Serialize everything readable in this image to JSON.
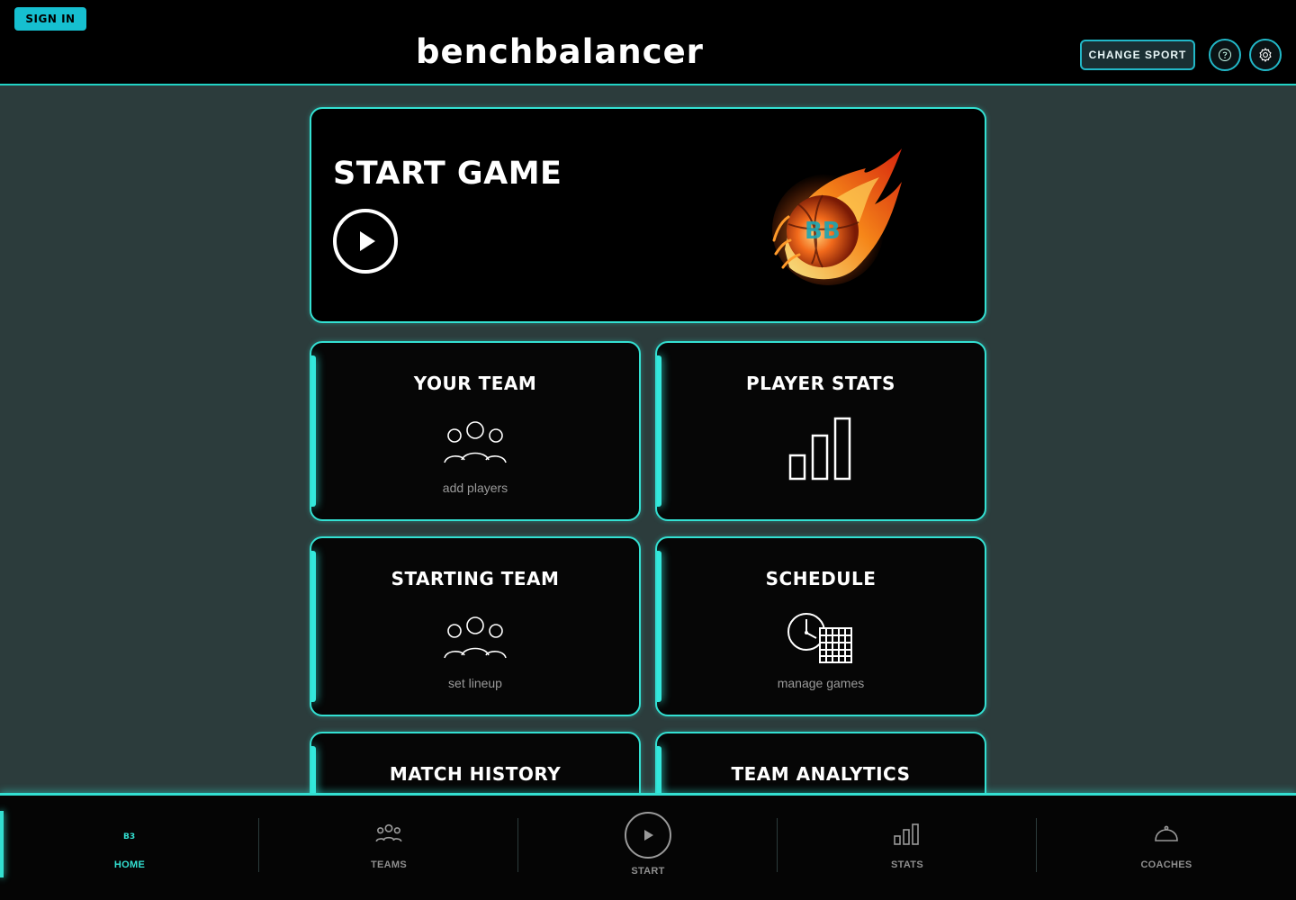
{
  "header": {
    "sign_in_label": "SIGN IN",
    "app_title": "benchbalancer",
    "change_sport_label": "CHANGE SPORT",
    "help_icon": "question-icon",
    "settings_icon": "gear-icon"
  },
  "start_game": {
    "title": "START GAME",
    "play_icon": "play-icon",
    "image": "flaming-basketball"
  },
  "tiles": {
    "your_team": {
      "title": "YOUR TEAM",
      "subtitle": "add players",
      "icon": "people-icon"
    },
    "player_stats": {
      "title": "PLAYER STATS",
      "subtitle": "",
      "icon": "bar-chart-icon"
    },
    "starting_team": {
      "title": "STARTING TEAM",
      "subtitle": "set lineup",
      "icon": "people-icon"
    },
    "schedule": {
      "title": "SCHEDULE",
      "subtitle": "manage games",
      "icon": "clock-calendar-icon"
    },
    "match_history": {
      "title": "MATCH HISTORY"
    },
    "team_analytics": {
      "title": "TEAM ANALYTICS"
    }
  },
  "bottom_nav": {
    "items": [
      {
        "label": "HOME",
        "icon": "bb-logo-icon",
        "active": true
      },
      {
        "label": "TEAMS",
        "icon": "people-icon",
        "active": false
      },
      {
        "label": "START",
        "icon": "play-icon",
        "active": false
      },
      {
        "label": "STATS",
        "icon": "bar-chart-icon",
        "active": false
      },
      {
        "label": "COACHES",
        "icon": "whistle-icon",
        "active": false
      }
    ]
  },
  "colors": {
    "accent": "#33e0d2",
    "sign_in_bg": "#16bfd0",
    "page_bg": "#2c3c3c",
    "card_bg": "#060606",
    "muted_text": "#9a9a9a"
  }
}
